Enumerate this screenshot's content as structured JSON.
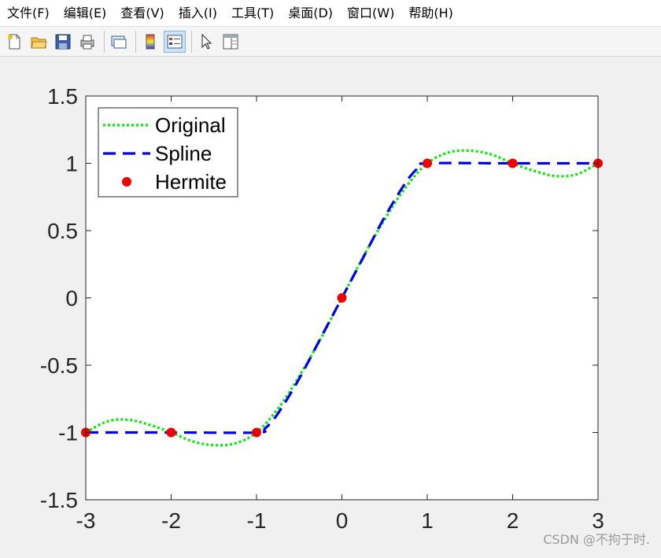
{
  "menu": [
    "文件(F)",
    "编辑(E)",
    "查看(V)",
    "插入(I)",
    "工具(T)",
    "桌面(D)",
    "窗口(W)",
    "帮助(H)"
  ],
  "toolbar": {
    "icons": [
      "new-file-icon",
      "open-folder-icon",
      "save-icon",
      "print-icon",
      "link-plot-icon",
      "colorbar-icon",
      "legend-icon",
      "pointer-icon",
      "property-editor-icon"
    ],
    "active": "legend-icon"
  },
  "watermark": "CSDN @不拘于时.",
  "chart_data": {
    "type": "line",
    "xlim": [
      -3,
      3
    ],
    "ylim": [
      -1.5,
      1.5
    ],
    "xticks": [
      -3,
      -2,
      -1,
      0,
      1,
      2,
      3
    ],
    "yticks": [
      1.5,
      1,
      0.5,
      0,
      -0.5,
      -1,
      -1.5
    ],
    "xtick_labels": [
      "-3",
      "-2",
      "-1",
      "0",
      "1",
      "2",
      "3"
    ],
    "ytick_labels": [
      "1.5",
      "1",
      "0.5",
      "0",
      "-0.5",
      "-1",
      "-1.5"
    ],
    "legend_position": "top-left",
    "grid": false,
    "series": [
      {
        "name": "Original",
        "style": "dotted",
        "color": "#00ee00",
        "x": [
          -3,
          -2.75,
          -2.5,
          -2.25,
          -2,
          -1.75,
          -1.5,
          -1.25,
          -1,
          -0.75,
          -0.5,
          -0.25,
          0,
          0.25,
          0.5,
          0.75,
          1,
          1.25,
          1.5,
          1.75,
          2,
          2.25,
          2.5,
          2.75,
          3
        ],
        "y": [
          -1,
          -0.918,
          -0.906,
          -0.944,
          -1,
          -1.066,
          -1.094,
          -1.081,
          -1,
          -0.824,
          -0.582,
          -0.305,
          0,
          0.305,
          0.582,
          0.824,
          1,
          1.081,
          1.094,
          1.066,
          1,
          0.944,
          0.906,
          0.918,
          1
        ]
      },
      {
        "name": "Spline",
        "style": "dashed",
        "color": "#0000ee",
        "x": [
          -3,
          -2,
          -1,
          -0.9,
          -0.75,
          -0.5,
          -0.25,
          0,
          0.25,
          0.5,
          0.75,
          0.9,
          1,
          2,
          3
        ],
        "y": [
          -1,
          -1,
          -1,
          -0.97,
          -0.86,
          -0.6,
          -0.3,
          0,
          0.3,
          0.6,
          0.86,
          0.97,
          1,
          1,
          1
        ]
      },
      {
        "name": "Hermite",
        "style": "markers",
        "color": "#ee0000",
        "x": [
          -3,
          -2,
          -1,
          0,
          1,
          2,
          3
        ],
        "y": [
          -1,
          -1,
          -1,
          0,
          1,
          1,
          1
        ]
      }
    ]
  }
}
